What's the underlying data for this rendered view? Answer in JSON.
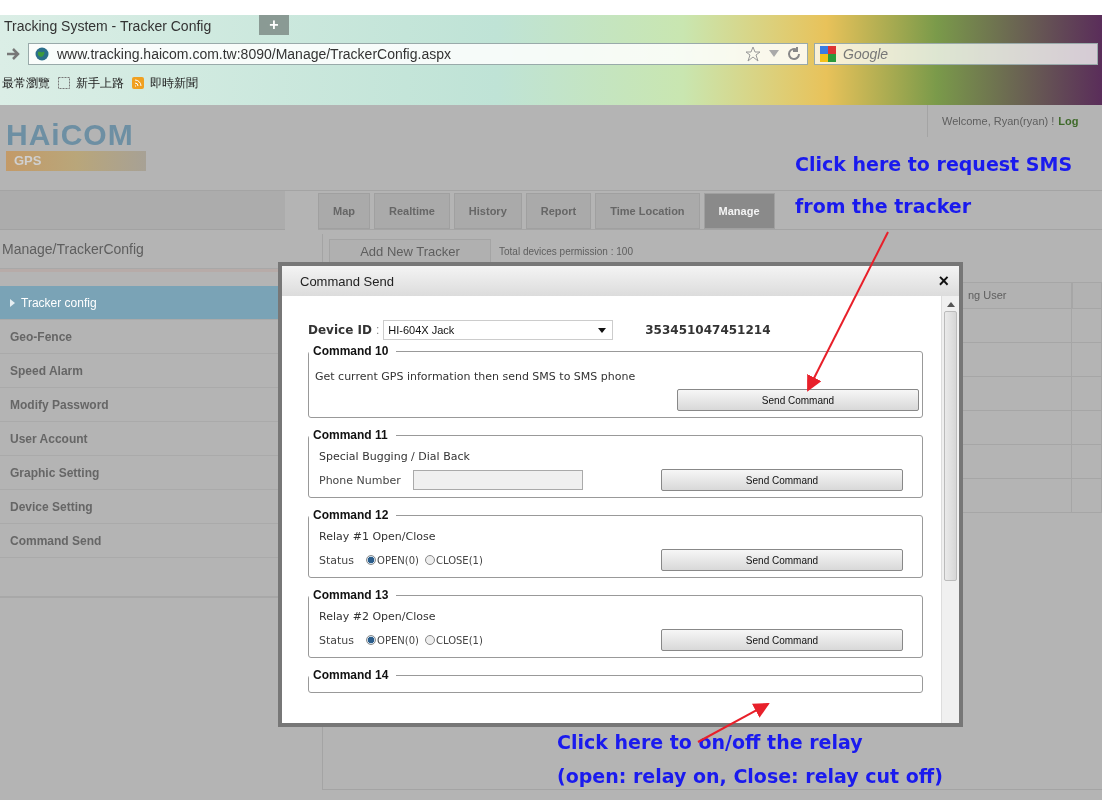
{
  "browser": {
    "tab_title": "Tracking System - Tracker Config",
    "new_tab": "+",
    "url": "www.tracking.haicom.com.tw:8090/Manage/TrackerConfig.aspx",
    "search_placeholder": "Google",
    "bookmarks": [
      {
        "label": "最常瀏覽",
        "kind": "plain"
      },
      {
        "label": "新手上路",
        "kind": "folder"
      },
      {
        "label": "即時新聞",
        "kind": "feed"
      }
    ]
  },
  "header": {
    "logo": "HAiCOM",
    "logo_sub": "GPS",
    "welcome": "Welcome, Ryan(ryan) !",
    "logout": "Log"
  },
  "nav_tabs": [
    {
      "label": "Map",
      "selected": false
    },
    {
      "label": "Realtime",
      "selected": false
    },
    {
      "label": "History",
      "selected": false
    },
    {
      "label": "Report",
      "selected": false
    },
    {
      "label": "Time Location",
      "selected": false
    },
    {
      "label": "Manage",
      "selected": true
    }
  ],
  "sidebar": {
    "title": "Manage/TrackerConfig",
    "items": [
      {
        "label": "Tracker config",
        "selected": true
      },
      {
        "label": "Geo-Fence",
        "selected": false
      },
      {
        "label": "Speed Alarm",
        "selected": false
      },
      {
        "label": "Modify Password",
        "selected": false
      },
      {
        "label": "User Account",
        "selected": false
      },
      {
        "label": "Graphic Setting",
        "selected": false
      },
      {
        "label": "Device Setting",
        "selected": false
      },
      {
        "label": "Command Send",
        "selected": false
      }
    ]
  },
  "content": {
    "add_button": "Add New Tracker",
    "permission": "Total devices permission : 100",
    "table": {
      "columns": [
        "ng User"
      ]
    }
  },
  "dialog": {
    "title": "Command Send",
    "close": "×",
    "device_label": "Device ID",
    "device_separator": ":",
    "device_value": "HI-604X Jack",
    "device_number": "353451047451214",
    "commands": [
      {
        "legend": "Command 10",
        "kind": "text",
        "description": "Get current GPS information then send SMS to SMS phone",
        "button": "Send Command"
      },
      {
        "legend": "Command 11",
        "kind": "phone",
        "description": "Special Bugging / Dial Back",
        "field_label": "Phone Number",
        "button": "Send Command"
      },
      {
        "legend": "Command 12",
        "kind": "relay",
        "description": "Relay #1 Open/Close",
        "field_label": "Status",
        "options": [
          {
            "label": "OPEN(0)",
            "selected": true
          },
          {
            "label": "CLOSE(1)",
            "selected": false
          }
        ],
        "button": "Send Command"
      },
      {
        "legend": "Command 13",
        "kind": "relay",
        "description": "Relay #2 Open/Close",
        "field_label": "Status",
        "options": [
          {
            "label": "OPEN(0)",
            "selected": true
          },
          {
            "label": "CLOSE(1)",
            "selected": false
          }
        ],
        "button": "Send Command"
      },
      {
        "legend": "Command 14",
        "kind": "cut"
      }
    ]
  },
  "annotations": [
    {
      "lines": [
        "Click here to request SMS",
        "from the tracker"
      ]
    },
    {
      "lines": [
        "Click here to on/off the relay",
        "(open: relay on, Close: relay cut off)"
      ]
    }
  ]
}
